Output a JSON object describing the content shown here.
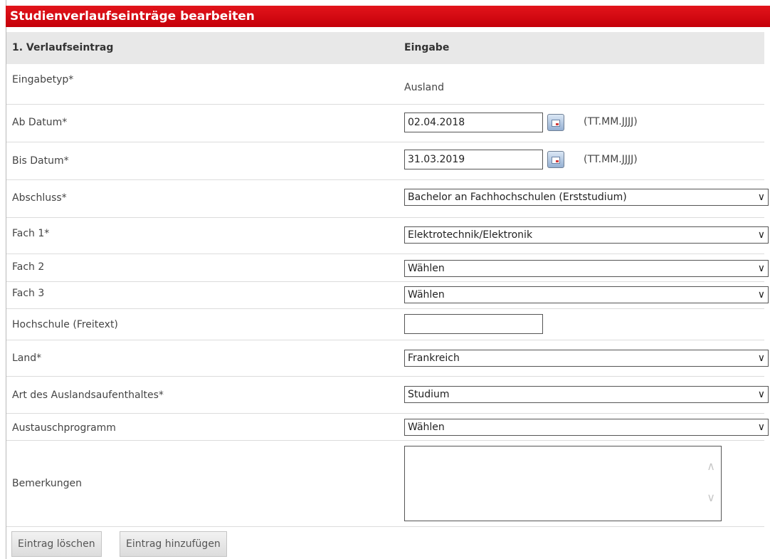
{
  "title": "Studienverlaufseinträge bearbeiten",
  "header": {
    "col1": "1. Verlaufseintrag",
    "col2": "Eingabe"
  },
  "rows": {
    "eingabetyp": {
      "label": "Eingabetyp*",
      "value": "Ausland"
    },
    "ab_datum": {
      "label": "Ab Datum*",
      "value": "02.04.2018",
      "format": "(TT.MM.JJJJ)"
    },
    "bis_datum": {
      "label": "Bis Datum*",
      "value": "31.03.2019",
      "format": "(TT.MM.JJJJ)"
    },
    "abschluss": {
      "label": "Abschluss*",
      "value": "Bachelor an Fachhochschulen (Erststudium)"
    },
    "fach1": {
      "label": "Fach 1*",
      "value": "Elektrotechnik/Elektronik"
    },
    "fach2": {
      "label": "Fach 2",
      "value": "Wählen"
    },
    "fach3": {
      "label": "Fach 3",
      "value": "Wählen"
    },
    "hochschule": {
      "label": "Hochschule (Freitext)",
      "value": ""
    },
    "land": {
      "label": "Land*",
      "value": "Frankreich"
    },
    "art": {
      "label": "Art des Auslandsaufenthaltes*",
      "value": "Studium"
    },
    "austausch": {
      "label": "Austauschprogramm",
      "value": "Wählen"
    },
    "bemerkungen": {
      "label": "Bemerkungen",
      "value": ""
    }
  },
  "buttons": {
    "delete": "Eintrag löschen",
    "add": "Eintrag hinzufügen"
  },
  "icons": {
    "calendar": "calendar-icon",
    "dropdown": "chevron-down-icon"
  },
  "colors": {
    "title_bar": "#d00812",
    "header_bg": "#e8e8e8"
  }
}
